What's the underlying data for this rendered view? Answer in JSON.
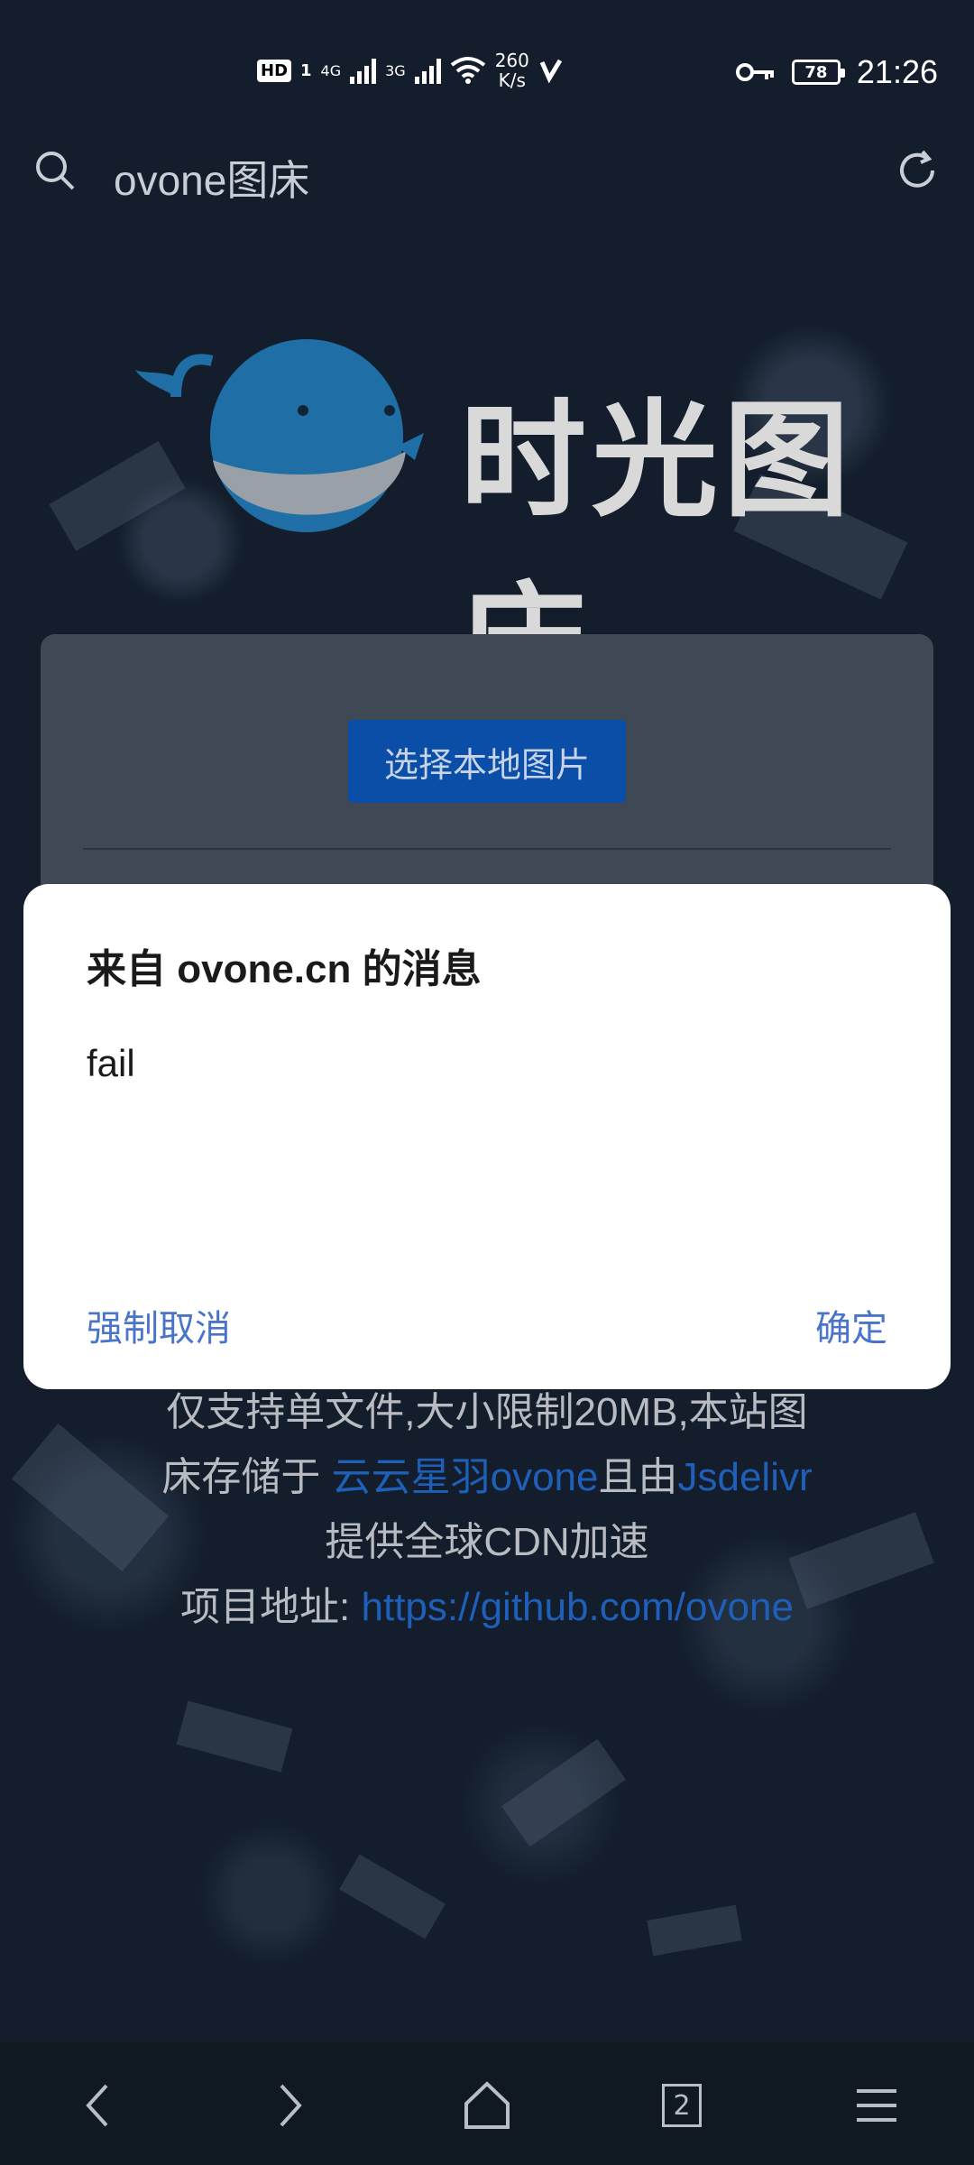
{
  "status_bar": {
    "hd_label": "HD",
    "sim_label": "1",
    "network_1": "4G",
    "network_2": "3G",
    "speed_value": "260",
    "speed_unit": "K/s",
    "battery": "78",
    "time": "21:26"
  },
  "address_bar": {
    "url_text": "ovone图床",
    "search_icon": "search-icon",
    "refresh_icon": "refresh-icon"
  },
  "logo": {
    "text": "时光图床",
    "colors": {
      "whale": "#1f6fa6",
      "belly": "#9aa0a8"
    }
  },
  "card": {
    "select_button": "选择本地图片"
  },
  "info": {
    "line1": "仅支持单文件,大小限制20MB,本站图",
    "line2_prefix": "床存储于 ",
    "line2_link1": "云云星羽ovone",
    "line2_mid": "且由",
    "line2_link2": "Jsdelivr",
    "line3": "提供全球CDN加速",
    "line4_prefix": "项目地址: ",
    "line4_link": "https://github.com/ovone"
  },
  "dialog": {
    "title": "来自 ovone.cn 的消息",
    "message": "fail",
    "cancel_label": "强制取消",
    "ok_label": "确定"
  },
  "bottom_nav": {
    "tab_count": "2",
    "icons": [
      "back-icon",
      "forward-icon",
      "home-icon",
      "tabs-icon",
      "menu-icon"
    ]
  },
  "colors": {
    "background": "#131d2b",
    "button": "#0b4ea8",
    "link": "#1f5fb8",
    "dialog_action": "#4a74c9"
  }
}
